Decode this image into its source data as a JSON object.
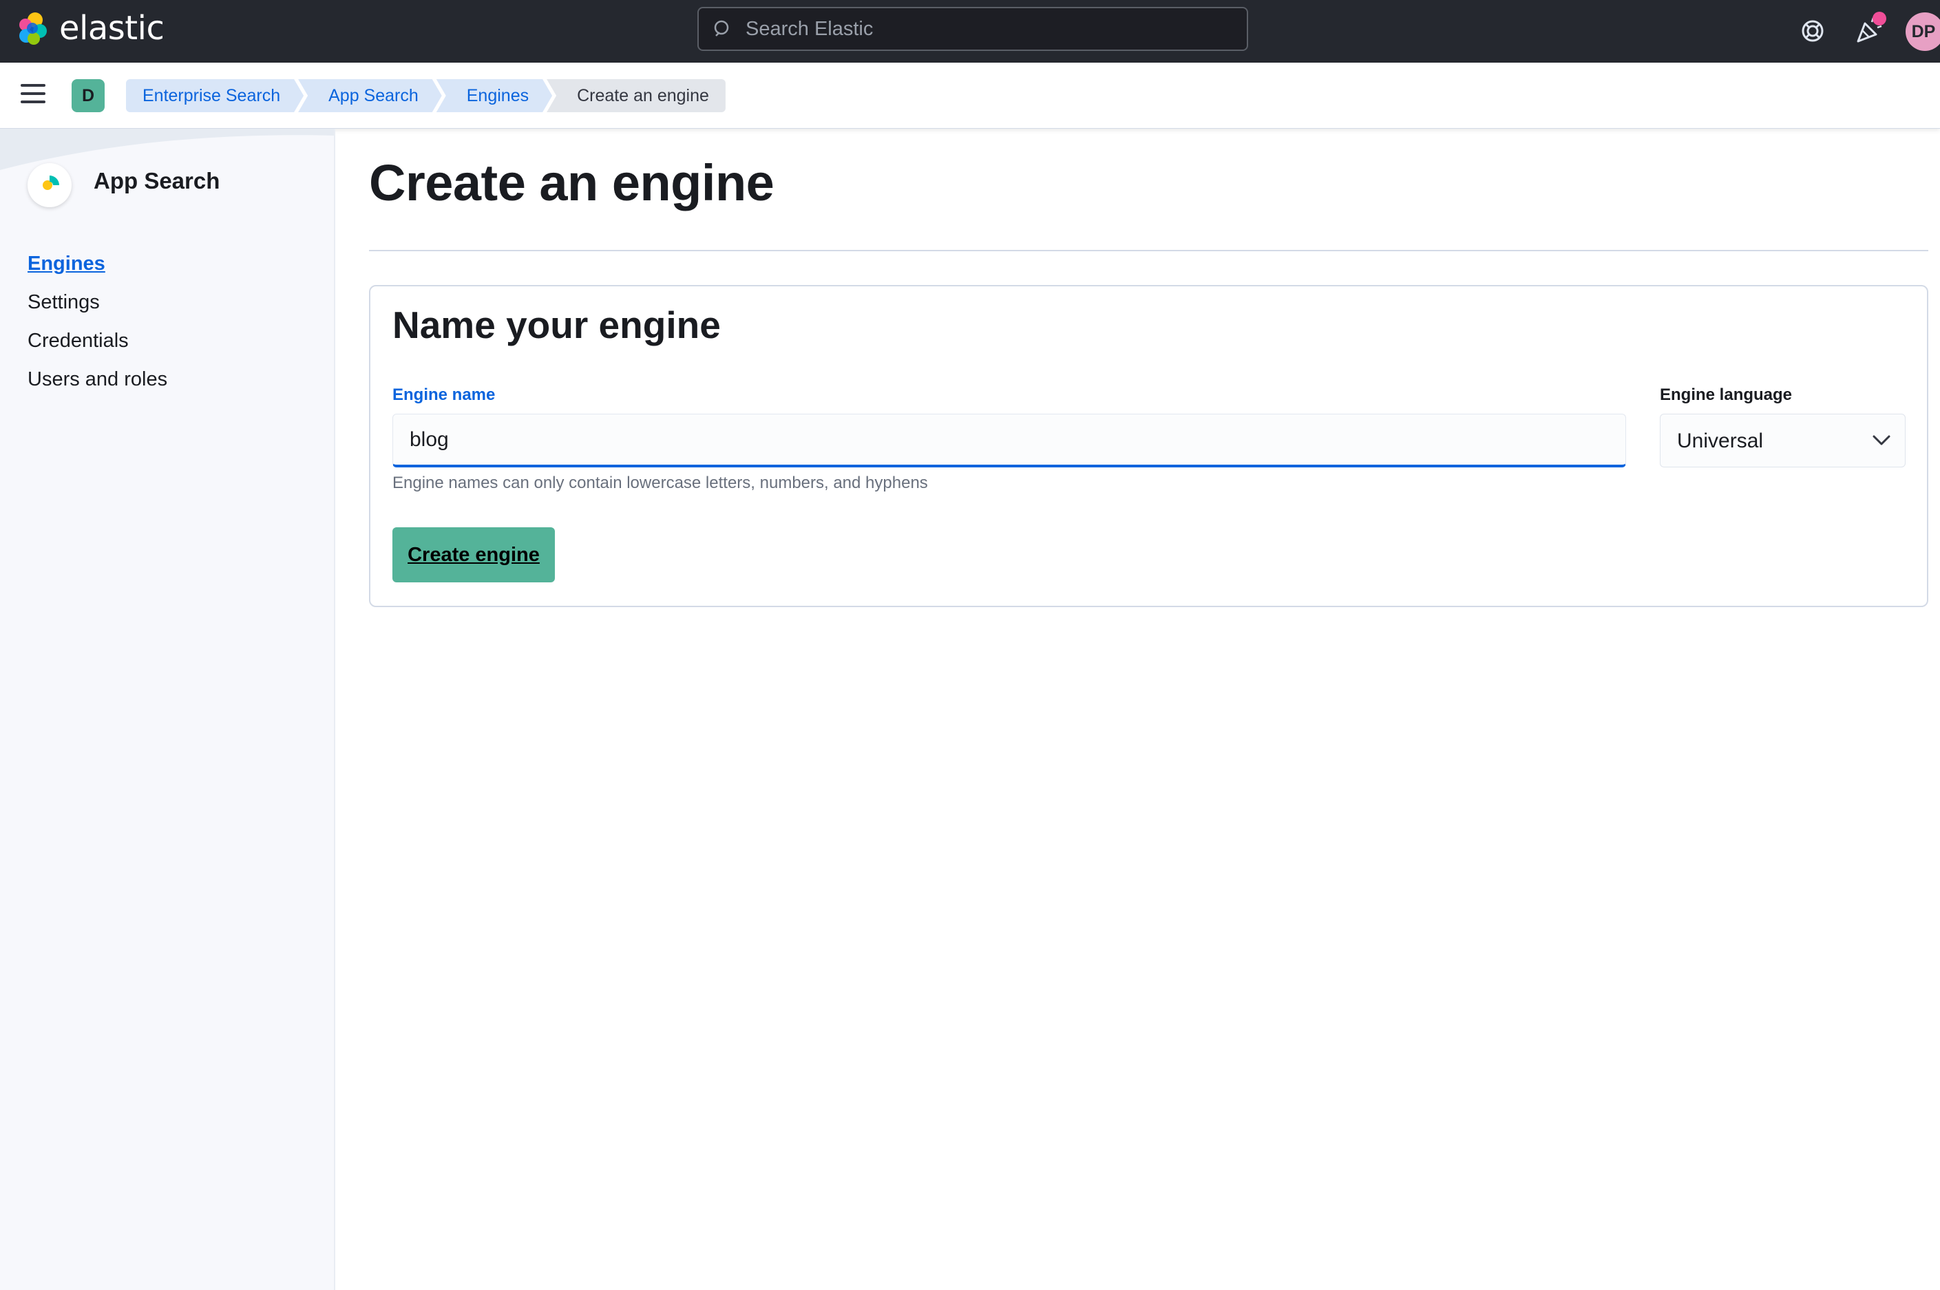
{
  "header": {
    "brand": "elastic",
    "search_placeholder": "Search Elastic",
    "help_icon": "help-lifebuoy-icon",
    "news_icon": "newsfeed-cheer-icon",
    "user_initials": "DP",
    "colors": {
      "bar": "#25282f",
      "notification_dot": "#f04e98",
      "user_avatar": "#e7a0c4"
    }
  },
  "subheader": {
    "menu_icon": "hamburger-menu-icon",
    "space_initial": "D",
    "space_color": "#54b399",
    "breadcrumbs": [
      {
        "label": "Enterprise Search"
      },
      {
        "label": "App Search"
      },
      {
        "label": "Engines"
      },
      {
        "label": "Create an engine"
      }
    ]
  },
  "sidebar": {
    "app_name": "App Search",
    "items": [
      {
        "label": "Engines",
        "active": true
      },
      {
        "label": "Settings",
        "active": false
      },
      {
        "label": "Credentials",
        "active": false
      },
      {
        "label": "Users and roles",
        "active": false
      }
    ]
  },
  "main": {
    "page_title": "Create an engine",
    "form": {
      "heading": "Name your engine",
      "engine_name_label": "Engine name",
      "engine_name_value": "blog",
      "engine_name_help": "Engine names can only contain lowercase letters, numbers, and hyphens",
      "language_label": "Engine language",
      "language_value": "Universal",
      "submit_label": "Create engine"
    },
    "colors": {
      "accent": "#0b64dd",
      "primary_button": "#54b399"
    }
  }
}
